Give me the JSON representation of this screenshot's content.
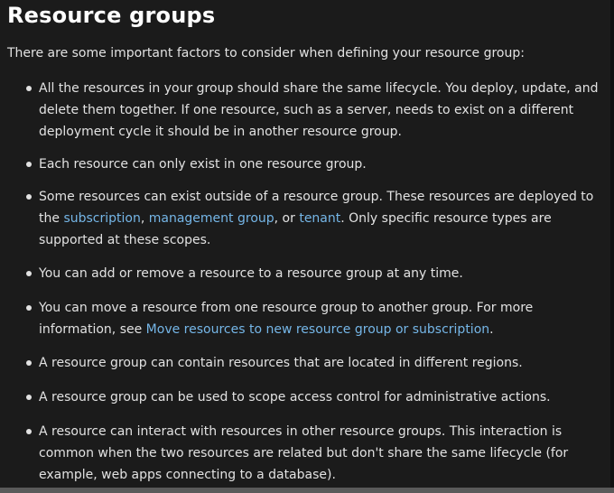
{
  "heading": "Resource groups",
  "intro": "There are some important factors to consider when defining your resource group:",
  "items": [
    {
      "text": "All the resources in your group should share the same lifecycle. You deploy, update, and delete them together. If one resource, such as a server, needs to exist on a different deployment cycle it should be in another resource group."
    },
    {
      "text": "Each resource can only exist in one resource group."
    },
    {
      "prefix": "Some resources can exist outside of a resource group. These resources are deployed to the ",
      "link1": "subscription",
      "sep1": ", ",
      "link2": "management group",
      "sep2": ", or ",
      "link3": "tenant",
      "suffix": ". Only specific resource types are supported at these scopes."
    },
    {
      "text": "You can add or remove a resource to a resource group at any time."
    },
    {
      "prefix": "You can move a resource from one resource group to another group. For more information, see ",
      "link": "Move resources to new resource group or subscription",
      "suffix": "."
    },
    {
      "text": "A resource group can contain resources that are located in different regions."
    },
    {
      "text": "A resource group can be used to scope access control for administrative actions."
    },
    {
      "text": "A resource can interact with resources in other resource groups. This interaction is common when the two resources are related but don't share the same lifecycle (for example, web apps connecting to a database)."
    }
  ],
  "colors": {
    "background": "#1b1b1b",
    "text": "#e2e2e2",
    "heading": "#ffffff",
    "link": "#75b6e7"
  }
}
